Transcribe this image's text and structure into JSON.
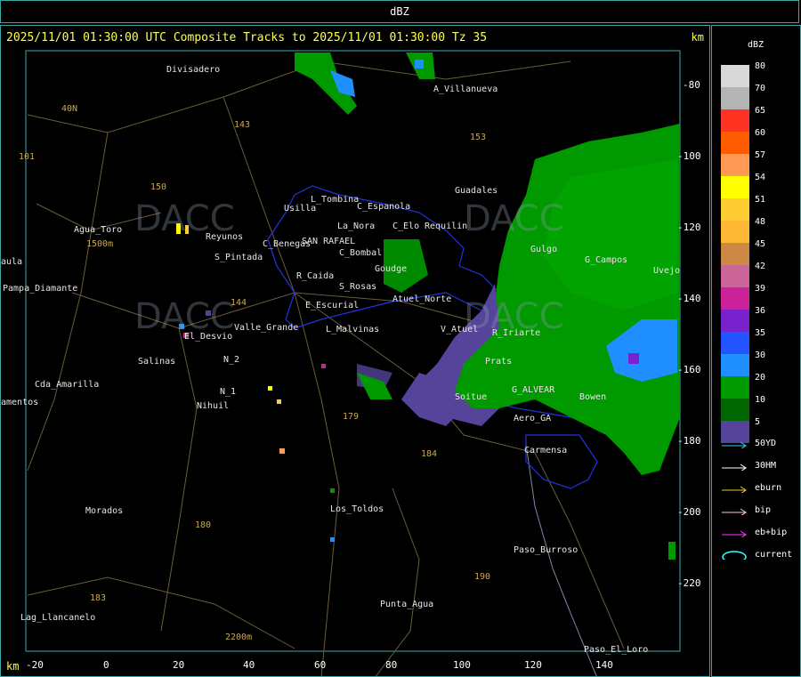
{
  "window": {
    "title": "dBZ"
  },
  "header": {
    "text": "2025/11/01 01:30:00 UTC Composite Tracks to 2025/11/01 01:30:00 Tz 35",
    "km_top": "km",
    "km_bottom": "km"
  },
  "axes": {
    "x_ticks": [
      "-20",
      "0",
      "20",
      "40",
      "60",
      "80",
      "100",
      "120",
      "140"
    ],
    "y_ticks": [
      "-80",
      "-100",
      "-120",
      "-140",
      "-160",
      "-180",
      "-200",
      "-220"
    ]
  },
  "places": [
    {
      "name": "Divisadero"
    },
    {
      "name": "A_Villanueva"
    },
    {
      "name": "Guadales"
    },
    {
      "name": "Usilla"
    },
    {
      "name": "L_Tombina"
    },
    {
      "name": "C_Espanola"
    },
    {
      "name": "Agua_Toro"
    },
    {
      "name": "S_Pintada"
    },
    {
      "name": "Reyunos"
    },
    {
      "name": "La_Nora"
    },
    {
      "name": "C_Elo"
    },
    {
      "name": "Requilin"
    },
    {
      "name": "C_Benegas"
    },
    {
      "name": "SAN RAFAEL"
    },
    {
      "name": "C_Bombal"
    },
    {
      "name": "Goudge"
    },
    {
      "name": "Gulgo"
    },
    {
      "name": "G_Campos"
    },
    {
      "name": "Uvejo"
    },
    {
      "name": "R_Caida"
    },
    {
      "name": "S_Rosas"
    },
    {
      "name": "E_Escurial"
    },
    {
      "name": "Atuel_Norte"
    },
    {
      "name": "Pampa_Diamante"
    },
    {
      "name": "Valle_Grande"
    },
    {
      "name": "L_Malvinas"
    },
    {
      "name": "V_Atuel"
    },
    {
      "name": "R_Iriarte"
    },
    {
      "name": "El_Desvio"
    },
    {
      "name": "Salinas"
    },
    {
      "name": "Prats"
    },
    {
      "name": "Cda_Amarilla"
    },
    {
      "name": "N_2"
    },
    {
      "name": "N_1"
    },
    {
      "name": "Nihuil"
    },
    {
      "name": "Soitue"
    },
    {
      "name": "G_ALVEAR"
    },
    {
      "name": "Bowen"
    },
    {
      "name": "Aero_GA"
    },
    {
      "name": "Carmensa"
    },
    {
      "name": "Morados"
    },
    {
      "name": "Los_Toldos"
    },
    {
      "name": "Paso_Burroso"
    },
    {
      "name": "Punta_Agua"
    },
    {
      "name": "Lag_Llancanelo"
    },
    {
      "name": "Paso_El_Loro"
    },
    {
      "name": "amentos"
    },
    {
      "name": "aula"
    }
  ],
  "routes": [
    "143",
    "153",
    "150",
    "40N",
    "101",
    "144",
    "179",
    "184",
    "180",
    "190",
    "183",
    "2200m",
    "1500m"
  ],
  "legend": {
    "title": "dBZ",
    "scale": [
      {
        "value": "80",
        "color": "#d8d8d8"
      },
      {
        "value": "70",
        "color": "#b4b4b4"
      },
      {
        "value": "65",
        "color": "#ff3322"
      },
      {
        "value": "60",
        "color": "#ff5c00"
      },
      {
        "value": "57",
        "color": "#ff9955"
      },
      {
        "value": "54",
        "color": "#ffff00"
      },
      {
        "value": "51",
        "color": "#ffcc33"
      },
      {
        "value": "48",
        "color": "#ffb833"
      },
      {
        "value": "45",
        "color": "#cc8844"
      },
      {
        "value": "42",
        "color": "#cc6699"
      },
      {
        "value": "39",
        "color": "#cc2299"
      },
      {
        "value": "36",
        "color": "#7722cc"
      },
      {
        "value": "35",
        "color": "#2255ff"
      },
      {
        "value": "30",
        "color": "#1f8fff"
      },
      {
        "value": "20",
        "color": "#009900"
      },
      {
        "value": "10",
        "color": "#006600"
      },
      {
        "value": "5",
        "color": "#55449a"
      }
    ],
    "tracks": [
      {
        "name": "50YD",
        "color": "#33ccff"
      },
      {
        "name": "30HM",
        "color": "#ffffff"
      },
      {
        "name": "eburn",
        "color": "#ffbb33"
      },
      {
        "name": "bip",
        "color": "#ffcccc"
      },
      {
        "name": "eb+bip",
        "color": "#ff33ff"
      },
      {
        "name": "current",
        "color": "#33ffff"
      }
    ]
  }
}
